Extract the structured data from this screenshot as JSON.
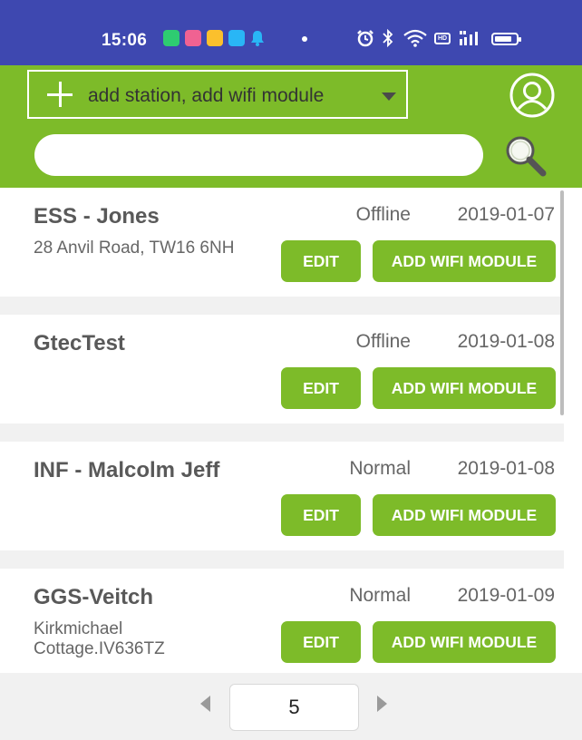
{
  "status_bar": {
    "time": "15:06",
    "icons": [
      "messages-app-icon",
      "pink-app-icon",
      "mail-app-icon",
      "photos-app-icon",
      "notification-bell-icon",
      "dot-icon",
      "alarm-icon",
      "bluetooth-icon",
      "wifi-icon",
      "hd-icon",
      "signal-5g-icon",
      "battery-icon"
    ],
    "hd_label": "HD"
  },
  "header": {
    "add_label": "add station, add wifi module",
    "search_placeholder": "",
    "accent_color": "#7dbb29"
  },
  "stations": [
    {
      "name": "ESS - Jones",
      "status": "Offline",
      "date": "2019-01-07",
      "address": "28 Anvil Road, TW16 6NH",
      "edit_label": "EDIT",
      "wifi_label": "ADD WIFI MODULE"
    },
    {
      "name": "GtecTest",
      "status": "Offline",
      "date": "2019-01-08",
      "address": "",
      "edit_label": "EDIT",
      "wifi_label": "ADD WIFI MODULE"
    },
    {
      "name": "INF - Malcolm Jeff",
      "status": "Normal",
      "date": "2019-01-08",
      "address": "",
      "edit_label": "EDIT",
      "wifi_label": "ADD WIFI MODULE"
    },
    {
      "name": "GGS-Veitch",
      "status": "Normal",
      "date": "2019-01-09",
      "address": "Kirkmichael Cottage.IV636TZ",
      "edit_label": "EDIT",
      "wifi_label": "ADD WIFI MODULE"
    }
  ],
  "pager": {
    "page": "5"
  }
}
